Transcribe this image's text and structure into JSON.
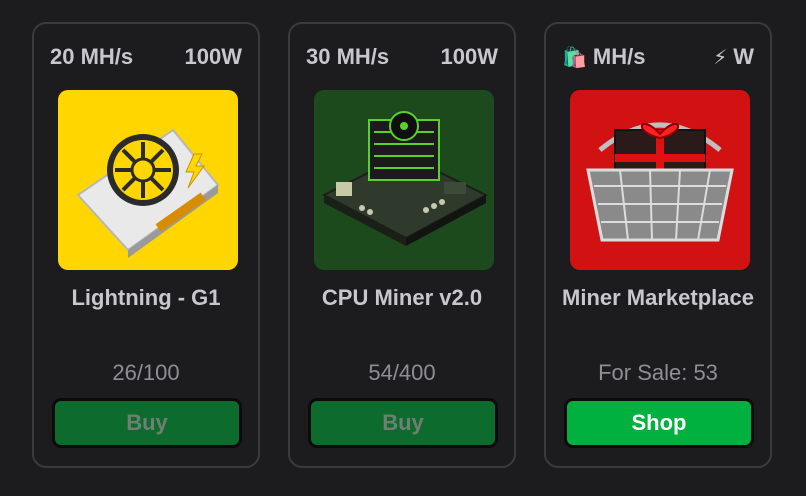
{
  "cards": [
    {
      "hashrate": "20 MH/s",
      "power": "100W",
      "name": "Lightning - G1",
      "stock": "26/100",
      "button": "Buy",
      "image": "gpu-card-icon"
    },
    {
      "hashrate": "30 MH/s",
      "power": "100W",
      "name": "CPU Miner v2.0",
      "stock": "54/400",
      "button": "Buy",
      "image": "cpu-board-icon"
    },
    {
      "hashrate_icon": "shopping-bag-icon",
      "hashrate": "MH/s",
      "power_icon": "lightning-bolt-icon",
      "power": "W",
      "name": "Miner Marketplace",
      "stock": "For Sale: 53",
      "button": "Shop",
      "image": "gift-basket-icon"
    }
  ],
  "glyphs": {
    "bag": "🛍️",
    "bolt": "⚡"
  },
  "colors": {
    "background": "#1c1c1e",
    "card_border": "#3a3a3d",
    "buy_button": "#0d6b2e",
    "shop_button": "#00b140",
    "text_primary": "#c7c7cc",
    "text_muted": "#8e8e93"
  }
}
